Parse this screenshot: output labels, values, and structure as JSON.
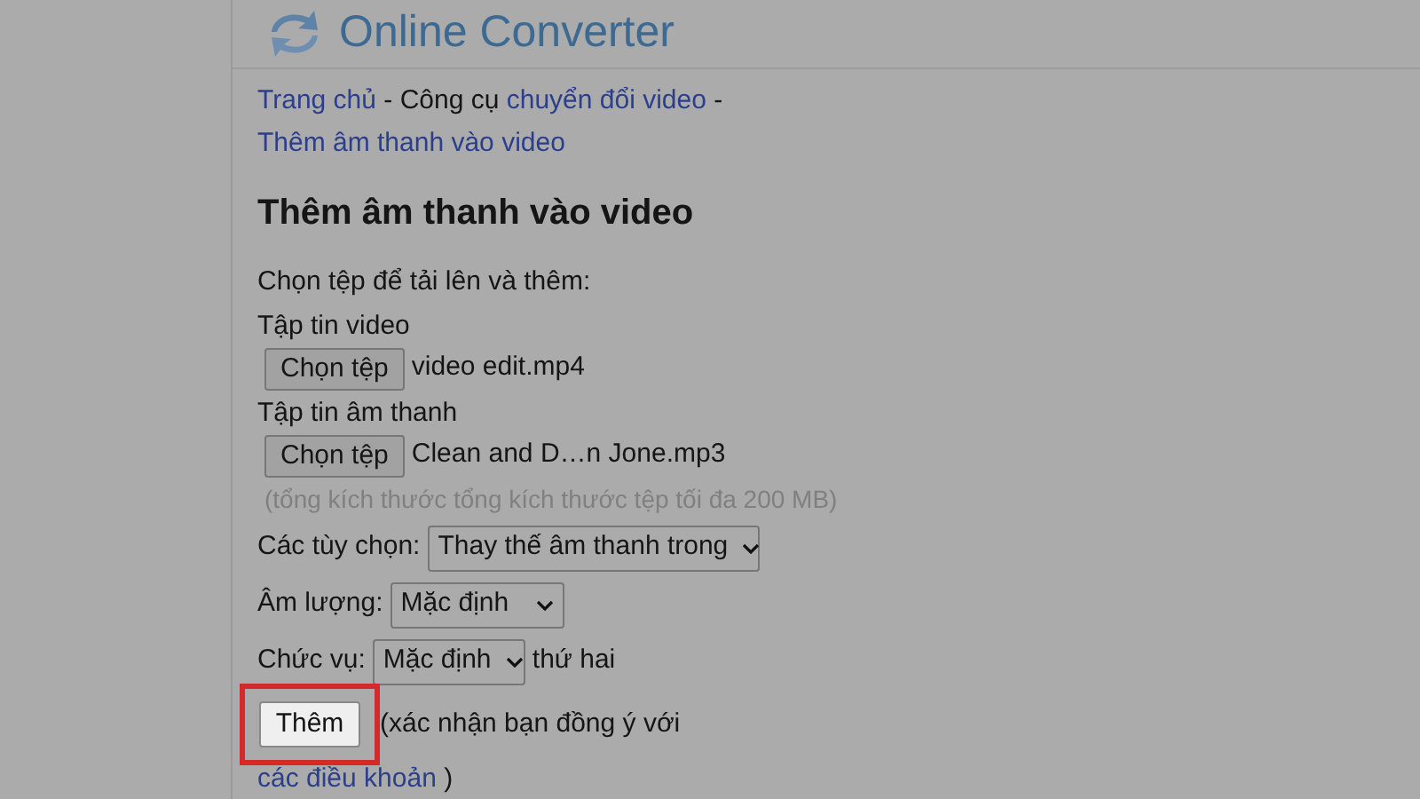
{
  "logo": {
    "text": "Online Converter"
  },
  "breadcrumb": [
    {
      "text": "Trang chủ",
      "kind": "link"
    },
    {
      "text": " - Công cụ ",
      "kind": "text"
    },
    {
      "text": "chuyển đổi video",
      "kind": "link"
    },
    {
      "text": " -",
      "kind": "text"
    },
    {
      "text": "Thêm âm thanh vào video",
      "kind": "link"
    }
  ],
  "heading": "Thêm âm thanh vào video",
  "intro": "Chọn tệp để tải lên và thêm:",
  "files": [
    {
      "label": "Tập tin video",
      "button": "Chọn tệp",
      "file": "video edit.mp4"
    },
    {
      "label": "Tập tin âm thanh",
      "button": "Chọn tệp",
      "file": "Clean and D…n Jone.mp3"
    }
  ],
  "size_note": "(tổng kích thước tổng kích thước tệp tối đa 200 MB)",
  "options": [
    {
      "label": "Các tùy chọn:",
      "value": "Thay thế âm thanh trong"
    },
    {
      "label": "Âm lượng:",
      "value": "Mặc định"
    },
    {
      "label": "Chức vụ:",
      "value": "Mặc định",
      "suffix": "thứ hai"
    }
  ],
  "submit": {
    "label": "Thêm",
    "highlighted": true
  },
  "terms": {
    "text": "(xác nhận bạn đồng ý với ",
    "link": "các điều khoản",
    "end": ")"
  }
}
